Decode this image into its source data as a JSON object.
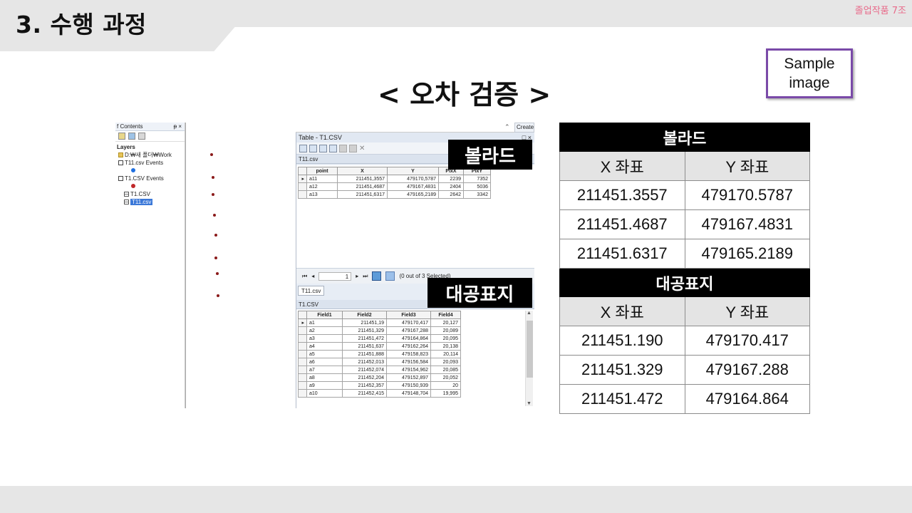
{
  "slide": {
    "title": "3. 수행 과정",
    "team_tag": "졸업작품 7조",
    "section_heading": "< 오차 검증 >",
    "sample_label": "Sample\nimage"
  },
  "arcmap": {
    "toc": {
      "header": "f Contents",
      "pin_glyphs": "ᵽ ×",
      "items": [
        {
          "label": "Layers"
        },
        {
          "label": "D:₩새 폴더₩Work"
        },
        {
          "label": "T11.csv Events"
        },
        {
          "label": "T1.CSV Events"
        },
        {
          "label": "T1.CSV"
        },
        {
          "label": "T11.csv"
        }
      ]
    },
    "create_tab": "Create",
    "table_window": {
      "title": "Table - T1.CSV",
      "controls": "□ ×",
      "subtitle": "T11.csv",
      "columns": [
        "point",
        "X",
        "Y",
        "PixX",
        "PixY"
      ],
      "rows": [
        [
          "a11",
          "211451,3557",
          "479170,5787",
          "2239",
          "7352"
        ],
        [
          "a12",
          "211451,4687",
          "479167,4831",
          "2404",
          "5036"
        ],
        [
          "a13",
          "211451,6317",
          "479165,2189",
          "2642",
          "3342"
        ]
      ],
      "record_value": "1",
      "selection_status": "(0 out of 3 Selected)",
      "tab_label": "T11.csv"
    },
    "second_table": {
      "title": "T1.CSV",
      "columns": [
        "Field1",
        "Field2",
        "Field3",
        "Field4"
      ],
      "rows": [
        [
          "a1",
          "211451,19",
          "479170,417",
          "20,127"
        ],
        [
          "a2",
          "211451,329",
          "479167,288",
          "20,089"
        ],
        [
          "a3",
          "211451,472",
          "479164,864",
          "20,095"
        ],
        [
          "a4",
          "211451,637",
          "479162,264",
          "20,138"
        ],
        [
          "a5",
          "211451,888",
          "479158,823",
          "20,114"
        ],
        [
          "a6",
          "211452,013",
          "479156,584",
          "20,093"
        ],
        [
          "a7",
          "211452,074",
          "479154,962",
          "20,085"
        ],
        [
          "a8",
          "211452,204",
          "479152,897",
          "20,052"
        ],
        [
          "a9",
          "211452,357",
          "479150,939",
          "20"
        ],
        [
          "a10",
          "211452,415",
          "479148,704",
          "19,995"
        ]
      ]
    },
    "overlay_bollard": "볼라드",
    "overlay_benchmark": "대공표지"
  },
  "comparison": {
    "bollard_title": "볼라드",
    "benchmark_title": "대공표지",
    "x_header": "X 좌표",
    "y_header": "Y 좌표",
    "bollard_rows": [
      [
        "211451.3557",
        "479170.5787"
      ],
      [
        "211451.4687",
        "479167.4831"
      ],
      [
        "211451.6317",
        "479165.2189"
      ]
    ],
    "benchmark_rows": [
      [
        "211451.190",
        "479170.417"
      ],
      [
        "211451.329",
        "479167.288"
      ],
      [
        "211451.472",
        "479164.864"
      ]
    ]
  },
  "colors": {
    "band_gray": "#e6e6e6",
    "team_tag_pink": "#e86a8a",
    "sample_border_purple": "#7a4aa8",
    "map_point_red": "#8b1a1a",
    "selected_layer_blue": "#3b78d8"
  }
}
